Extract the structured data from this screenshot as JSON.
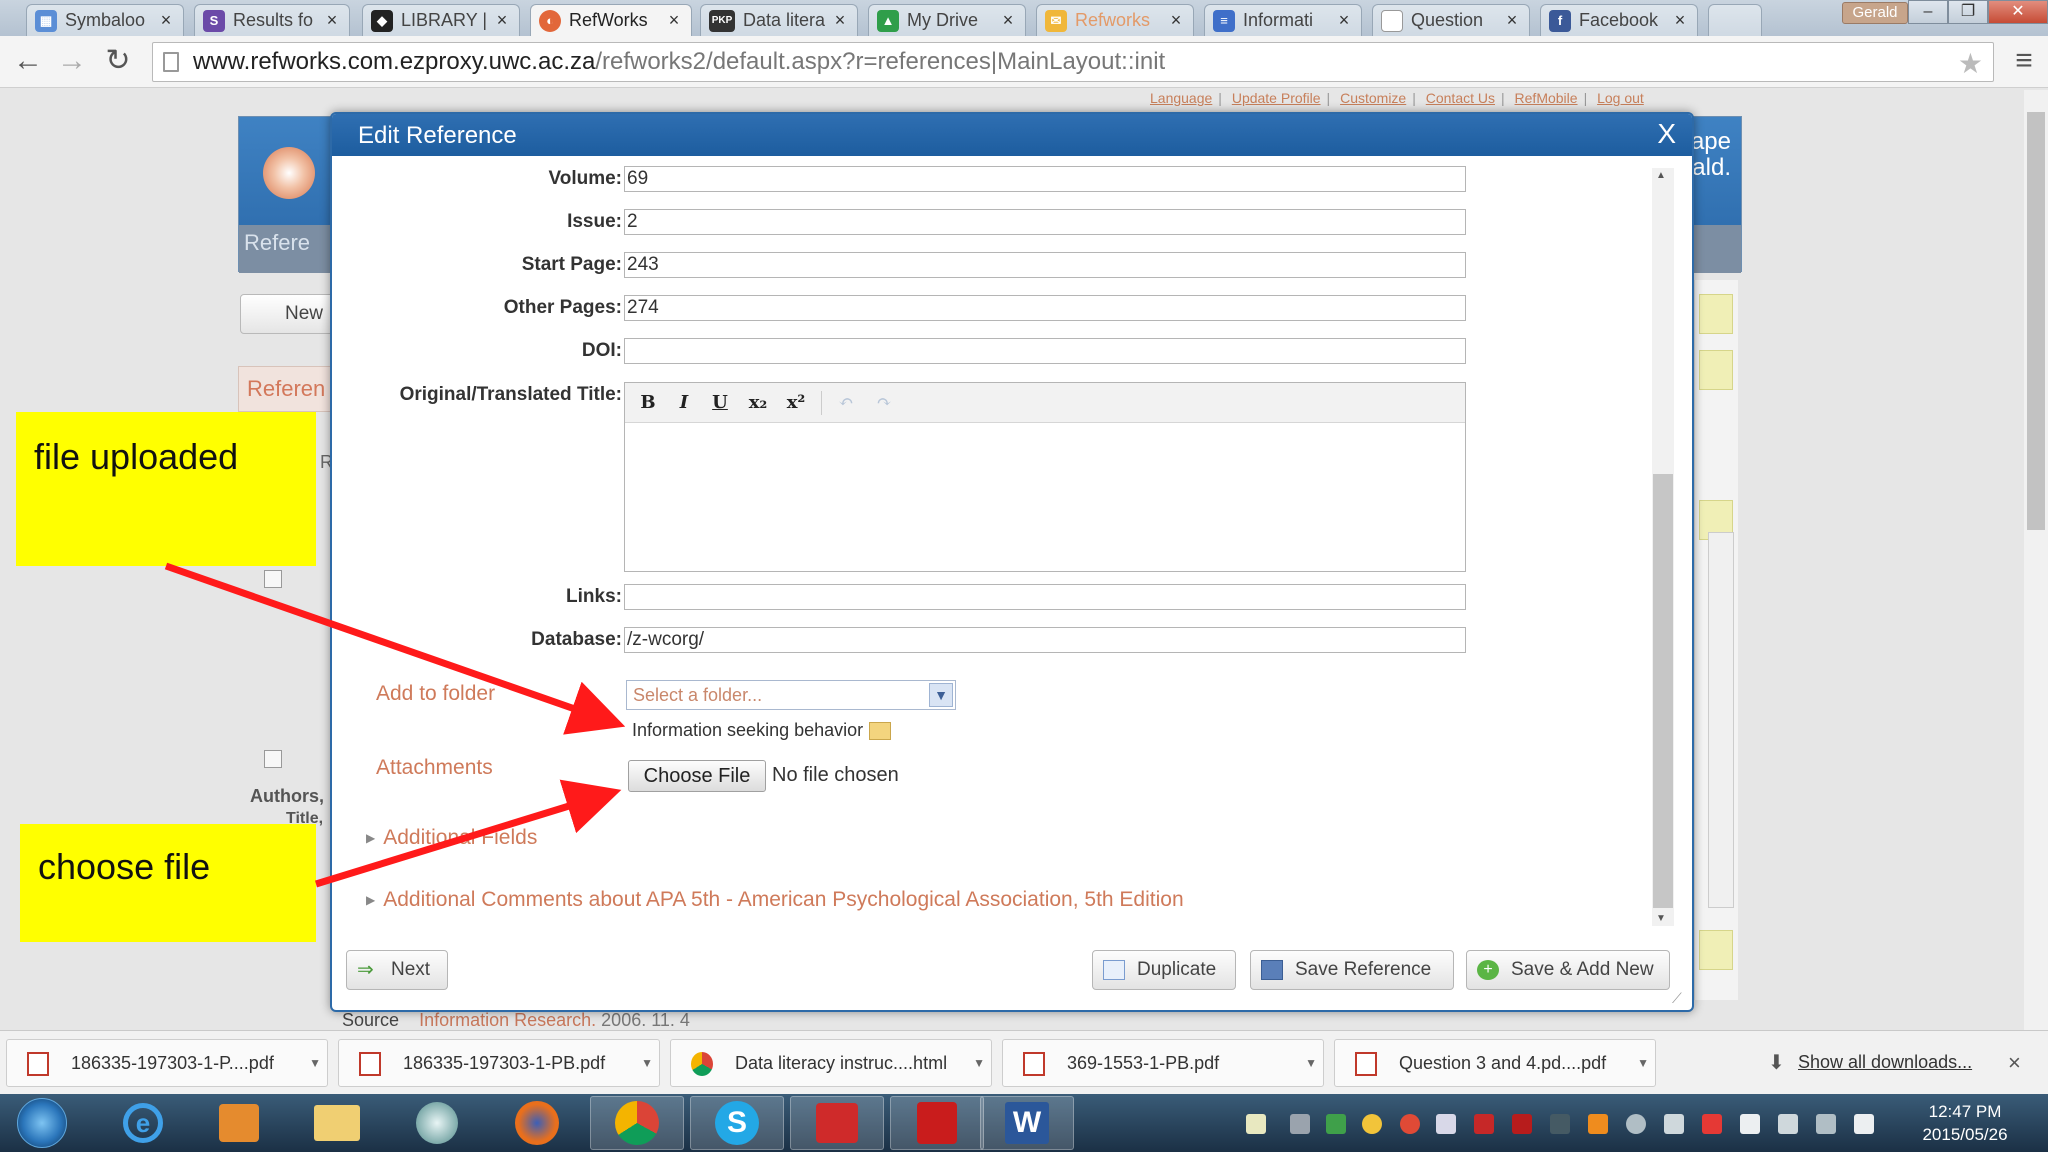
{
  "browser": {
    "tabs": [
      {
        "title": "Symbaloo",
        "icon": "symbaloo-icon",
        "color": "#5b8ed6"
      },
      {
        "title": "Results fo",
        "icon": "swirl-icon",
        "color": "#6b4aa8"
      },
      {
        "title": "LIBRARY |",
        "icon": "library-icon",
        "color": "#222222"
      },
      {
        "title": "RefWorks",
        "icon": "refworks-icon",
        "color": "#e2673a",
        "active": true
      },
      {
        "title": "Data litera",
        "icon": "pkp-icon",
        "color": "#333333"
      },
      {
        "title": "My Drive",
        "icon": "drive-icon",
        "color": "#2f9e4a"
      },
      {
        "title": "Refworks",
        "icon": "mail-icon",
        "color": "#f0b73a"
      },
      {
        "title": "Informati",
        "icon": "docs-icon",
        "color": "#3f6fc9"
      },
      {
        "title": "Question",
        "icon": "page-icon",
        "color": "#999999"
      },
      {
        "title": "Facebook",
        "icon": "facebook-icon",
        "color": "#3b5998"
      }
    ],
    "tab_close": "×",
    "user": "Gerald",
    "url_host": "www.refworks.com.ezproxy.uwc.ac.za",
    "url_path": "/refworks2/default.aspx?r=references|MainLayout::init"
  },
  "toplinks": [
    "Language",
    "Update Profile",
    "Customize",
    "Contact Us",
    "RefMobile",
    "Log out"
  ],
  "background": {
    "header_right_1": "ape",
    "header_right_2": "ald.",
    "tab_label": "Refere",
    "new_button": "New",
    "refer_bar": "Referen",
    "r_text": "R",
    "authors": "Authors,",
    "title": "Title,",
    "source_label": "Source",
    "source_value": "Information Research.",
    "source_rest": "2006. 11. 4"
  },
  "modal": {
    "title": "Edit Reference",
    "close": "X",
    "fields": {
      "volume": {
        "label": "Volume:",
        "value": "69"
      },
      "issue": {
        "label": "Issue:",
        "value": "2"
      },
      "start_page": {
        "label": "Start Page:",
        "value": "243"
      },
      "other_pages": {
        "label": "Other Pages:",
        "value": "274"
      },
      "doi": {
        "label": "DOI:",
        "value": ""
      },
      "orig_title": {
        "label": "Original/Translated Title:"
      },
      "links": {
        "label": "Links:",
        "value": ""
      },
      "database": {
        "label": "Database:",
        "value": "/z-wcorg/"
      }
    },
    "toolbar": {
      "bold": "B",
      "italic": "I",
      "underline": "U",
      "subscript": "x₂",
      "superscript": "x²",
      "undo": "↶",
      "redo": "↷"
    },
    "add_to_folder": {
      "label": "Add to folder",
      "placeholder": "Select a folder...",
      "folder_chip": "Information seeking behavior"
    },
    "attachments": {
      "label": "Attachments",
      "button": "Choose File",
      "status": "No file chosen"
    },
    "additional_fields": "Additional Fields",
    "additional_comments": "Additional Comments about APA 5th - American Psychological Association, 5th Edition",
    "buttons": {
      "next": "Next",
      "duplicate": "Duplicate",
      "save": "Save Reference",
      "save_add": "Save & Add New"
    }
  },
  "annotations": {
    "uploaded": "file uploaded",
    "choose": "choose file",
    "arrow_color": "#ff1a1a",
    "highlight_color": "#ffff00"
  },
  "downloads": {
    "items": [
      {
        "name": "186335-197303-1-P....pdf",
        "icon": "pdf-icon"
      },
      {
        "name": "186335-197303-1-PB.pdf",
        "icon": "pdf-icon"
      },
      {
        "name": "Data literacy instruc....html",
        "icon": "chrome-icon"
      },
      {
        "name": "369-1553-1-PB.pdf",
        "icon": "pdf-icon"
      },
      {
        "name": "Question 3 and 4.pd....pdf",
        "icon": "pdf-icon"
      }
    ],
    "show_all": "Show all downloads...",
    "close": "×"
  },
  "taskbar": {
    "apps": [
      "ie-icon",
      "media-player-icon",
      "explorer-icon",
      "globe-icon",
      "firefox-icon",
      "chrome-icon",
      "skype-icon",
      "remote-desktop-icon",
      "acrobat-icon",
      "word-icon"
    ],
    "time": "12:47 PM",
    "date": "2015/05/26"
  }
}
